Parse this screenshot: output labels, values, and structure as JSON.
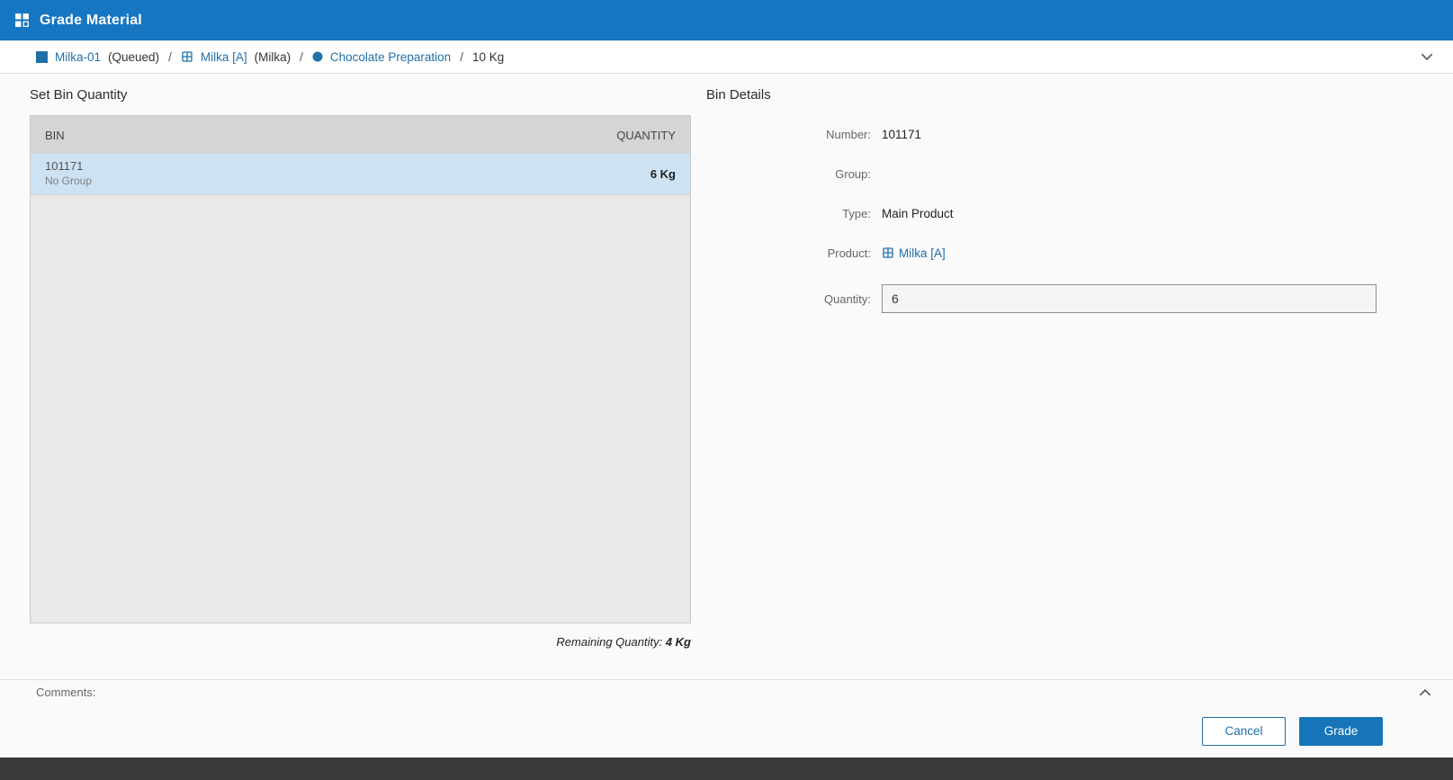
{
  "colors": {
    "header_bg": "#1776c2",
    "accent_blue": "#2170a8",
    "grade_button_bg": "#1774b8",
    "selected_row_bg": "#cde2f2",
    "table_header_bg": "#d5d5d5"
  },
  "header": {
    "title": "Grade Material"
  },
  "breadcrumb": {
    "operation": "Milka-01",
    "operation_status": "(Queued)",
    "product": "Milka [A]",
    "product_name": "(Milka)",
    "step": "Chocolate Preparation",
    "quantity": "10 Kg",
    "separator": "/"
  },
  "bin_panel": {
    "title": "Set Bin Quantity",
    "columns": {
      "bin": "BIN",
      "quantity": "QUANTITY"
    },
    "rows": [
      {
        "number": "101171",
        "group": "No Group",
        "quantity": "6 Kg"
      }
    ],
    "remaining_label": "Remaining Quantity:",
    "remaining_value": "4 Kg"
  },
  "bin_details": {
    "title": "Bin Details",
    "fields": {
      "number": {
        "label": "Number:",
        "value": "101171"
      },
      "group": {
        "label": "Group:",
        "value": ""
      },
      "type": {
        "label": "Type:",
        "value": "Main Product"
      },
      "product": {
        "label": "Product:",
        "value": "Milka [A]"
      },
      "quantity": {
        "label": "Quantity:",
        "value": "6"
      }
    }
  },
  "comments": {
    "label": "Comments:"
  },
  "footer": {
    "cancel": "Cancel",
    "grade": "Grade"
  }
}
